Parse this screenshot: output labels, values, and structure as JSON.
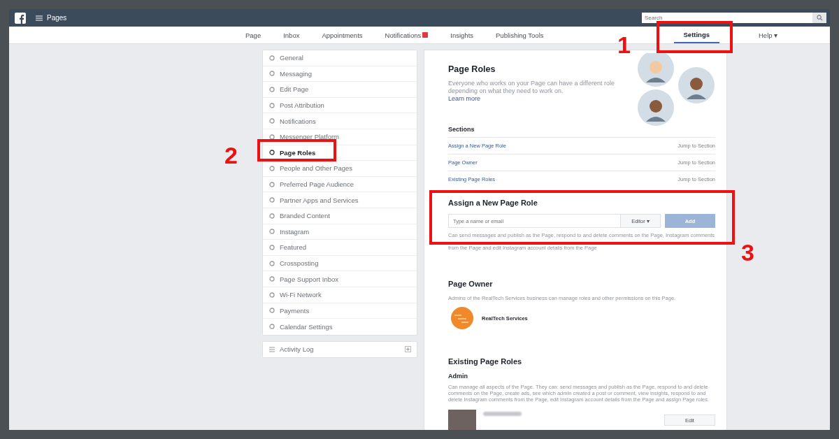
{
  "topbar": {
    "title": "Pages",
    "search": {
      "placeholder": "Search"
    }
  },
  "nav_tabs": [
    {
      "label": "Page",
      "selected": false
    },
    {
      "label": "Inbox",
      "selected": false
    },
    {
      "label": "Appointments",
      "selected": false
    },
    {
      "label": "Notifications",
      "selected": false,
      "badge": true
    },
    {
      "label": "Insights",
      "selected": false
    },
    {
      "label": "Publishing Tools",
      "selected": false
    },
    {
      "label": "Settings",
      "selected": true
    },
    {
      "label": "Help ▾",
      "selected": false
    }
  ],
  "sidebar": {
    "items": [
      {
        "label": "General",
        "selected": false
      },
      {
        "label": "Messaging",
        "selected": false
      },
      {
        "label": "Edit Page",
        "selected": false
      },
      {
        "label": "Post Attribution",
        "selected": false
      },
      {
        "label": "Notifications",
        "selected": false
      },
      {
        "label": "Messenger Platform",
        "selected": false
      },
      {
        "label": "Page Roles",
        "selected": true
      },
      {
        "label": "People and Other Pages",
        "selected": false
      },
      {
        "label": "Preferred Page Audience",
        "selected": false
      },
      {
        "label": "Partner Apps and Services",
        "selected": false
      },
      {
        "label": "Branded Content",
        "selected": false
      },
      {
        "label": "Instagram",
        "selected": false
      },
      {
        "label": "Featured",
        "selected": false
      },
      {
        "label": "Crossposting",
        "selected": false
      },
      {
        "label": "Page Support Inbox",
        "selected": false
      },
      {
        "label": "Wi-Fi Network",
        "selected": false
      },
      {
        "label": "Payments",
        "selected": false
      },
      {
        "label": "Calendar Settings",
        "selected": false
      }
    ],
    "activity_log": "Activity Log"
  },
  "page_roles": {
    "title": "Page Roles",
    "description": "Everyone who works on your Page can have a different role depending on what they need to work on.",
    "learn_more": "Learn more",
    "sections_title": "Sections",
    "sections": [
      {
        "label": "Assign a New Page Role",
        "jump": "Jump to Section"
      },
      {
        "label": "Page Owner",
        "jump": "Jump to Section"
      },
      {
        "label": "Existing Page Roles",
        "jump": "Jump to Section"
      }
    ]
  },
  "assign": {
    "title": "Assign a New Page Role",
    "placeholder": "Type a name or email",
    "role": "Editor ▾",
    "add": "Add",
    "description": "Can send messages and publish as the Page, respond to and delete comments on the Page, Instagram comments from the Page and edit Instagram account details from the Page"
  },
  "owner": {
    "title": "Page Owner",
    "description": "Admins of the RealTech Services business can manage roles and other permissions on this Page.",
    "name": "RealTech Services"
  },
  "existing": {
    "title": "Existing Page Roles",
    "role": "Admin",
    "description": "Can manage all aspects of the Page. They can: send messages and publish as the Page, respond to and delete comments on the Page, create ads, see which admin created a post or comment, view insights, respond to and delete Instagram comments from the Page, edit Instagram account details from the Page and assign Page roles.",
    "edit": "Edit"
  },
  "annotations": [
    "1",
    "2",
    "3"
  ]
}
